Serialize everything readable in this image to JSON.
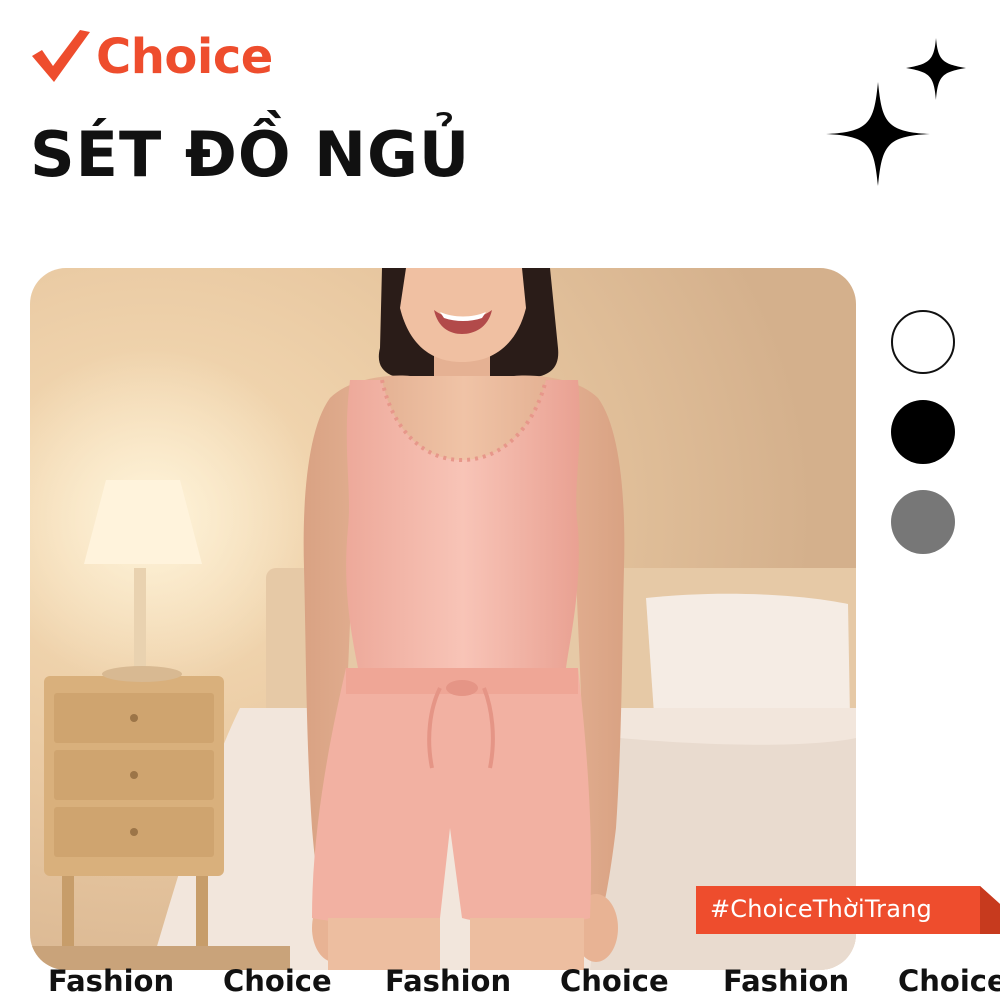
{
  "brand": {
    "name": "Choice",
    "check_icon": "checkmark-icon",
    "color": "#ee4d2d"
  },
  "title": "SÉT ĐỒ NGỦ",
  "decoration": {
    "icon": "sparkle-icon"
  },
  "product_image": {
    "icon": "model-photo"
  },
  "color_options": [
    {
      "name": "white",
      "color": "#ffffff"
    },
    {
      "name": "black",
      "color": "#000000"
    },
    {
      "name": "gray",
      "color": "#777777"
    }
  ],
  "hashtag": {
    "text": "#ChoiceThờiTrang",
    "color": "#ee4d2d"
  },
  "ticker": {
    "words": [
      "Fashion",
      "Choice",
      "Fashion",
      "Choice",
      "Fashion",
      "Choice"
    ]
  }
}
